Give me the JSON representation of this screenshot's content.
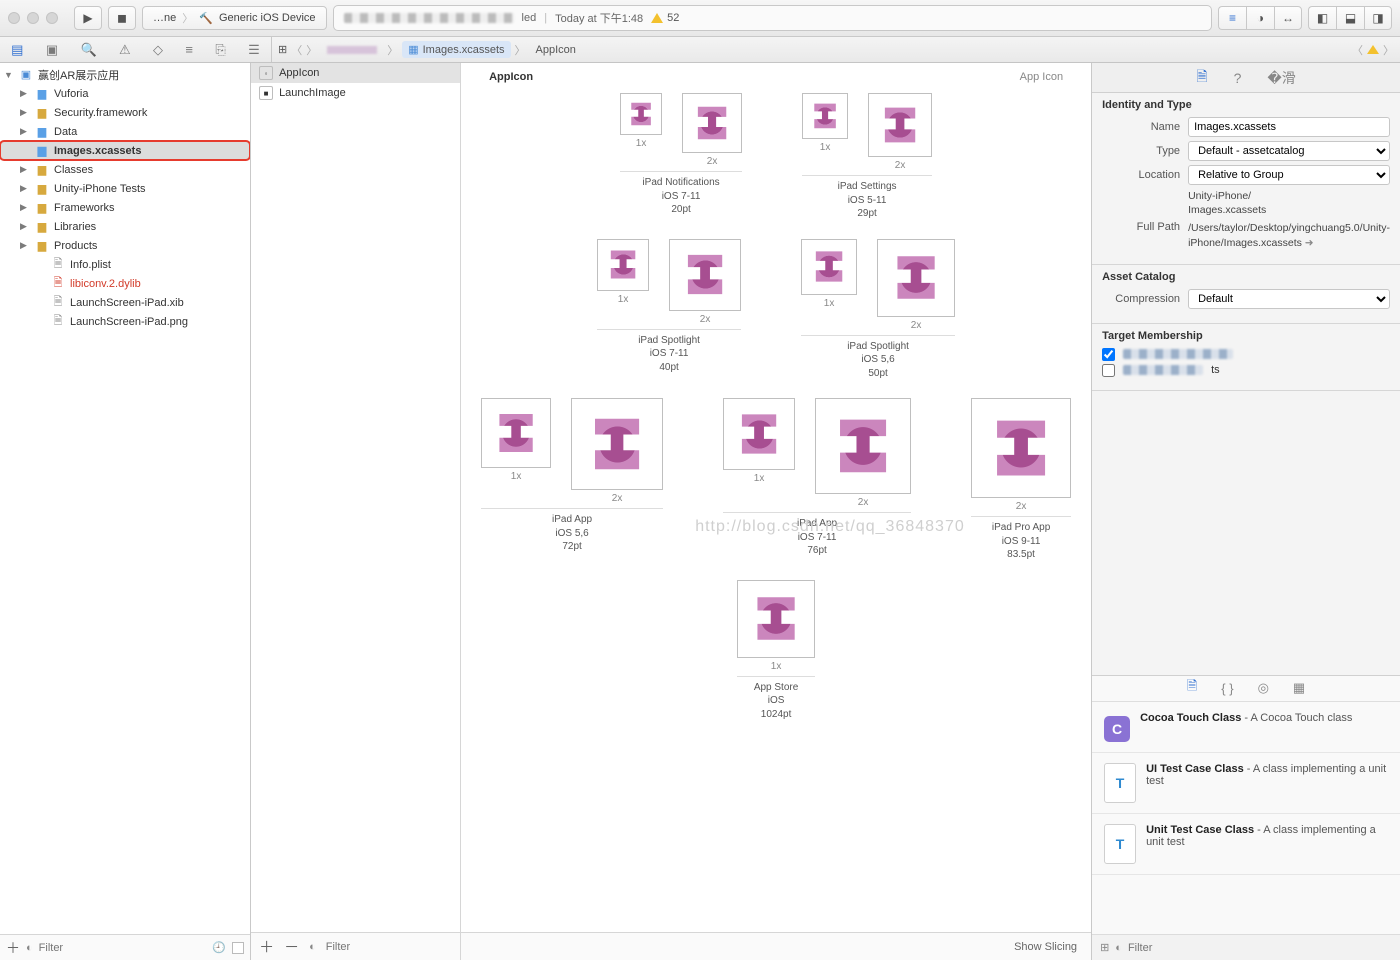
{
  "toolbar": {
    "scheme_app": "…ne",
    "scheme_device": "Generic iOS Device",
    "status_suffix": "led",
    "status_time": "Today at 下午1:48",
    "status_warn": "52"
  },
  "jumpbar": {
    "crumbs": [
      "…",
      "Images.xcassets",
      "AppIcon"
    ]
  },
  "project": {
    "root": "赢创AR展示应用",
    "items": [
      {
        "label": "Vuforia",
        "kind": "folder-blue",
        "depth": 1,
        "disc": "▶"
      },
      {
        "label": "Security.framework",
        "kind": "folder-yellow",
        "depth": 1,
        "disc": "▶"
      },
      {
        "label": "Data",
        "kind": "folder-blue",
        "depth": 1,
        "disc": "▶"
      },
      {
        "label": "Images.xcassets",
        "kind": "folder-blue",
        "depth": 1,
        "disc": "",
        "sel": true,
        "hl": true
      },
      {
        "label": "Classes",
        "kind": "folder-yellow",
        "depth": 1,
        "disc": "▶"
      },
      {
        "label": "Unity-iPhone Tests",
        "kind": "folder-yellow",
        "depth": 1,
        "disc": "▶"
      },
      {
        "label": "Frameworks",
        "kind": "folder-yellow",
        "depth": 1,
        "disc": "▶"
      },
      {
        "label": "Libraries",
        "kind": "folder-yellow",
        "depth": 1,
        "disc": "▶"
      },
      {
        "label": "Products",
        "kind": "folder-yellow",
        "depth": 1,
        "disc": "▶"
      },
      {
        "label": "Info.plist",
        "kind": "file-plain",
        "depth": 2,
        "disc": ""
      },
      {
        "label": "libiconv.2.dylib",
        "kind": "file-red",
        "depth": 2,
        "disc": ""
      },
      {
        "label": "LaunchScreen-iPad.xib",
        "kind": "file-plain",
        "depth": 2,
        "disc": ""
      },
      {
        "label": "LaunchScreen-iPad.png",
        "kind": "file-plain",
        "depth": 2,
        "disc": ""
      }
    ],
    "filter_placeholder": "Filter"
  },
  "assets": {
    "items": [
      {
        "label": "AppIcon",
        "sel": true,
        "ico": "◦"
      },
      {
        "label": "LaunchImage",
        "sel": false,
        "ico": "■"
      }
    ],
    "filter_placeholder": "Filter"
  },
  "canvas": {
    "title": "AppIcon",
    "kind": "App Icon",
    "show_slicing": "Show Slicing",
    "watermark": "http://blog.csdn.net/qq_36848370",
    "groups": [
      [
        {
          "name": "iPad Notifications",
          "sub": "iOS 7-11",
          "pt": "20pt",
          "slots": [
            {
              "size": 42,
              "scale": "1x",
              "filled": true
            },
            {
              "size": 60,
              "scale": "2x",
              "filled": true
            }
          ]
        },
        {
          "name": "iPad Settings",
          "sub": "iOS 5-11",
          "pt": "29pt",
          "slots": [
            {
              "size": 46,
              "scale": "1x",
              "filled": true
            },
            {
              "size": 64,
              "scale": "2x",
              "filled": true
            }
          ]
        }
      ],
      [
        {
          "name": "iPad Spotlight",
          "sub": "iOS 7-11",
          "pt": "40pt",
          "slots": [
            {
              "size": 52,
              "scale": "1x",
              "filled": true
            },
            {
              "size": 72,
              "scale": "2x",
              "filled": true
            }
          ]
        },
        {
          "name": "iPad Spotlight",
          "sub": "iOS 5,6",
          "pt": "50pt",
          "slots": [
            {
              "size": 56,
              "scale": "1x",
              "filled": true
            },
            {
              "size": 78,
              "scale": "2x",
              "filled": true
            }
          ]
        }
      ],
      [
        {
          "name": "iPad App",
          "sub": "iOS 5,6",
          "pt": "72pt",
          "slots": [
            {
              "size": 70,
              "scale": "1x",
              "filled": true
            },
            {
              "size": 92,
              "scale": "2x",
              "filled": true
            }
          ]
        },
        {
          "name": "iPad App",
          "sub": "iOS 7-11",
          "pt": "76pt",
          "slots": [
            {
              "size": 72,
              "scale": "1x",
              "filled": true
            },
            {
              "size": 96,
              "scale": "2x",
              "filled": true
            }
          ]
        },
        {
          "name": "iPad Pro App",
          "sub": "iOS 9-11",
          "pt": "83.5pt",
          "slots": [
            {
              "size": 100,
              "scale": "2x",
              "filled": true
            }
          ]
        }
      ],
      [
        {
          "name": "App Store",
          "sub": "iOS",
          "pt": "1024pt",
          "slots": [
            {
              "size": 78,
              "scale": "1x",
              "filled": true
            }
          ]
        }
      ]
    ]
  },
  "inspector": {
    "identity_title": "Identity and Type",
    "name_label": "Name",
    "name_value": "Images.xcassets",
    "type_label": "Type",
    "type_value": "Default - assetcatalog",
    "location_label": "Location",
    "location_value": "Relative to Group",
    "location_path": "Unity-iPhone/\nImages.xcassets",
    "fullpath_label": "Full Path",
    "fullpath_value": "/Users/taylor/Desktop/yingchuang5.0/Unity-iPhone/Images.xcassets",
    "catalog_title": "Asset Catalog",
    "compression_label": "Compression",
    "compression_value": "Default",
    "membership_title": "Target Membership",
    "membership_suffix": "ts"
  },
  "library": {
    "items": [
      {
        "title": "Cocoa Touch Class",
        "desc": " - A Cocoa Touch class",
        "ico": "C",
        "cls": "c"
      },
      {
        "title": "UI Test Case Class",
        "desc": " - A class implementing a unit test",
        "ico": "T",
        "cls": "t"
      },
      {
        "title": "Unit Test Case Class",
        "desc": " - A class implementing a unit test",
        "ico": "T",
        "cls": "t"
      }
    ],
    "filter_placeholder": "Filter"
  }
}
